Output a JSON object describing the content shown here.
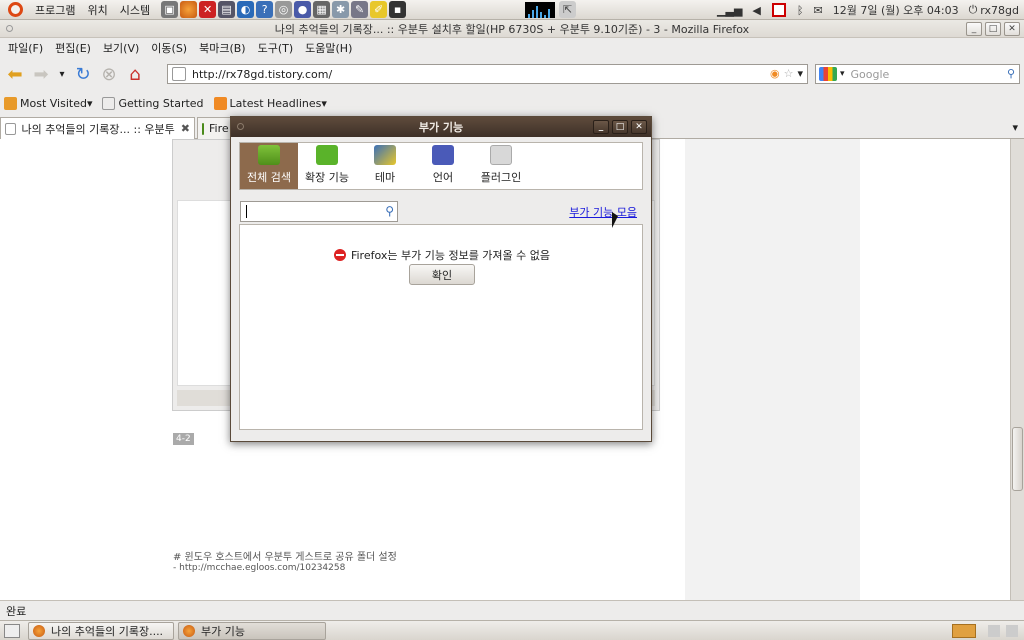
{
  "top_panel": {
    "menus": [
      "프로그램",
      "위치",
      "시스템"
    ],
    "clock": "12월  7일 (월) 오후 04:03",
    "user": "rx78gd"
  },
  "window": {
    "title": "나의 추억들의 기록장... :: 우분투 설치후 할일(HP 6730S + 우분투 9.10기준) - 3 - Mozilla Firefox"
  },
  "menubar": [
    "파일(F)",
    "편집(E)",
    "보기(V)",
    "이동(S)",
    "북마크(B)",
    "도구(T)",
    "도움말(H)"
  ],
  "navbar": {
    "url": "http://rx78gd.tistory.com/",
    "search_placeholder": "Google"
  },
  "bookmarks": [
    "Most Visited",
    "Getting Started",
    "Latest Headlines"
  ],
  "tabs": [
    {
      "label": "나의 추억들의 기록장... :: 우분투"
    },
    {
      "label": "Fire"
    }
  ],
  "content": {
    "caption_tag": "4-2",
    "note1": "# 윈도우 호스트에서 우분투 게스트로 공유 폴더 설정",
    "note2": "- http://mcchae.egloos.com/10234258"
  },
  "status": "완료",
  "taskbar": [
    {
      "label": "나의 추억들의 기록장...."
    },
    {
      "label": "부가 기능"
    }
  ],
  "dialog": {
    "title": "부가 기능",
    "tabs": [
      {
        "label": "전체 검색",
        "icon": "download-icon",
        "active": true
      },
      {
        "label": "확장 기능",
        "icon": "puzzle-icon"
      },
      {
        "label": "테마",
        "icon": "theme-icon"
      },
      {
        "label": "언어",
        "icon": "language-flag-icon"
      },
      {
        "label": "플러그인",
        "icon": "plugin-icon"
      }
    ],
    "browse_link": "부가 기능 모음",
    "error_message": "Firefox는 부가 기능 정보를 가져올 수 없음",
    "ok_label": "확인"
  },
  "colors": {
    "dialog_title": "#4e3d31",
    "active_tab": "#8d6a4c",
    "link": "#1a1adb",
    "error": "#dd2222"
  }
}
